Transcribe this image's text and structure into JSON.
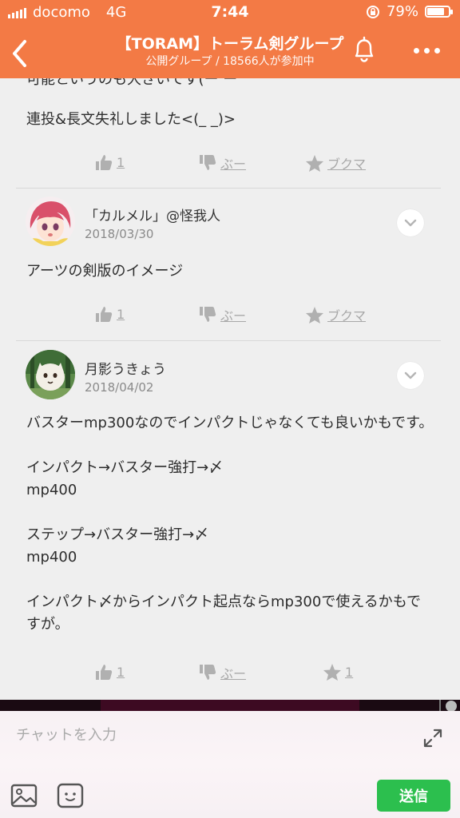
{
  "status_bar": {
    "carrier": "docomo",
    "network": "4G",
    "time": "7:44",
    "battery": "79%",
    "battery_level": 0.79
  },
  "header": {
    "title": "【TORAM】トーラム剣グループ",
    "subtitle": "公開グループ / 18566人が参加中",
    "back_icon": "chevron-left-icon",
    "bell_icon": "bell-icon",
    "more_icon": "more-dots-icon"
  },
  "posts": [
    {
      "partial_line": "可能というのも大きいです(ー ー",
      "body": "連投&長文失礼しました<(_ _)>",
      "likes": "1",
      "boo": "ぶー",
      "bookmark": "ブクマ"
    },
    {
      "author": "「カルメル」@怪我人",
      "date": "2018/03/30",
      "body": "アーツの剣版のイメージ",
      "likes": "1",
      "boo": "ぶー",
      "bookmark": "ブクマ"
    },
    {
      "author": "月影うきょう",
      "date": "2018/04/02",
      "body": "バスターmp300なのでインパクトじゃなくても良いかもです。\n\nインパクト→バスター強打→〆\nmp400\n\nステップ→バスター強打→〆\nmp400\n\nインパクト〆からインパクト起点ならmp300で使えるかもですが。",
      "likes": "1",
      "boo": "ぶー",
      "bookmarks": "1"
    }
  ],
  "composer": {
    "placeholder": "チャットを入力",
    "send_label": "送信"
  },
  "colors": {
    "header": "#f37a45",
    "send": "#2cbf4e",
    "background": "#efefef"
  }
}
